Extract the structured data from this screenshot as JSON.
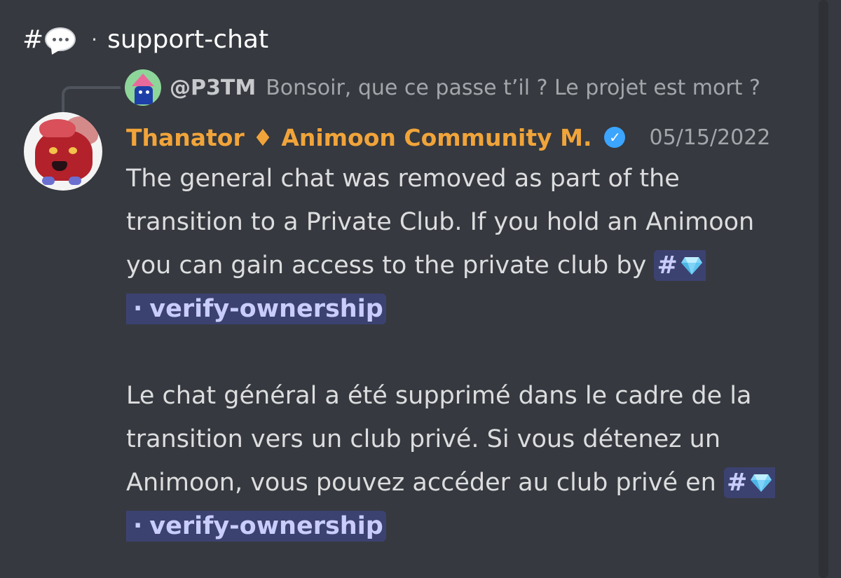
{
  "channel": {
    "hash": "#",
    "icon": "speech-bubble-icon",
    "separator": "·",
    "name": "support-chat"
  },
  "reply": {
    "author": "@P3TM",
    "text": "Bonsoir, que ce passe t’il ? Le projet est mort ?"
  },
  "message": {
    "author": "Thanator ♦ Animoon Community M.",
    "verified_icon": "verified-badge-icon",
    "verified_mark": "✓",
    "timestamp": "05/15/2022",
    "para1_text": "The general chat was removed as part of the transition to a Private Club. If you hold an Animoon you can gain access to the private club by",
    "para2_text": "Le chat général a été supprimé dans le cadre de la transition vers un club privé. Si vous détenez un Animoon, vous pouvez accéder au club privé en",
    "mention": {
      "hash": "#",
      "icon": "gem-icon",
      "separator": "·",
      "channel": "verify-ownership"
    }
  },
  "colors": {
    "background": "#36393f",
    "author": "#f1a43a",
    "mention_bg": "#3c4270",
    "mention_text": "#c9cdfb",
    "verified": "#3ba5ff"
  }
}
